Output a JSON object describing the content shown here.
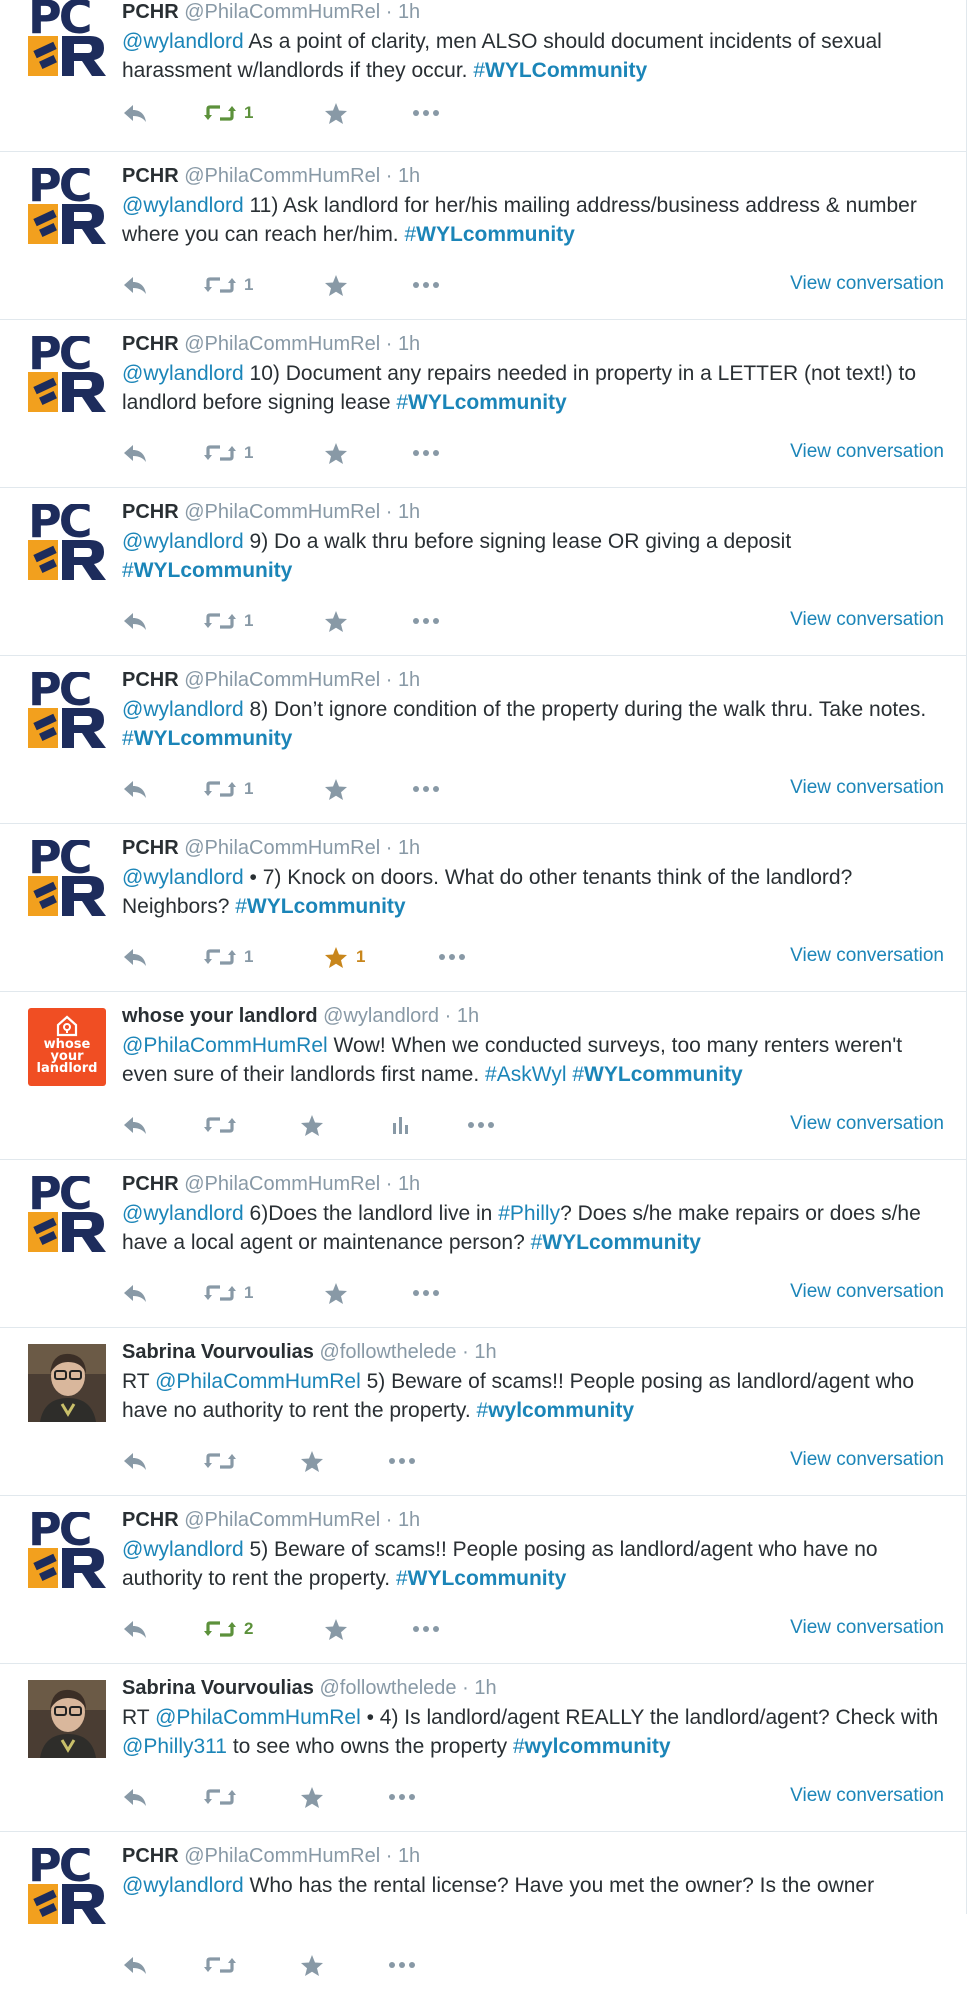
{
  "labels": {
    "view_conversation": "View conversation",
    "pc": "PC"
  },
  "wyl_logo_text": [
    "whose",
    "your",
    "landlord"
  ],
  "tweets": [
    {
      "avatar": "pchr",
      "name": "PCHR",
      "handle": "@PhilaCommHumRel",
      "dot": "·",
      "time": "1h",
      "segments": [
        {
          "t": "link",
          "v": "@wylandlord"
        },
        {
          "t": "text",
          "v": " As a point of clarity, men ALSO should document incidents of sexual harassment w/landlords if they occur. "
        },
        {
          "t": "hashtag",
          "hash": "#",
          "v": "WYLCommunity"
        }
      ],
      "retweets": "1",
      "retweet_active": true,
      "favorites": "",
      "favorite_active": false,
      "stats_icon": false,
      "view_conversation": false
    },
    {
      "avatar": "pchr",
      "name": "PCHR",
      "handle": "@PhilaCommHumRel",
      "dot": "·",
      "time": "1h",
      "segments": [
        {
          "t": "link",
          "v": "@wylandlord"
        },
        {
          "t": "text",
          "v": " 11) Ask landlord for her/his mailing address/business address & number where you can reach her/him. "
        },
        {
          "t": "hashtag",
          "hash": "#",
          "v": "WYLcommunity"
        }
      ],
      "retweets": "1",
      "retweet_active": false,
      "favorites": "",
      "favorite_active": false,
      "stats_icon": false,
      "view_conversation": true
    },
    {
      "avatar": "pchr",
      "name": "PCHR",
      "handle": "@PhilaCommHumRel",
      "dot": "·",
      "time": "1h",
      "segments": [
        {
          "t": "link",
          "v": "@wylandlord"
        },
        {
          "t": "text",
          "v": " 10) Document any repairs needed in property in a LETTER (not text!) to landlord before signing lease "
        },
        {
          "t": "hashtag",
          "hash": "#",
          "v": "WYLcommunity"
        }
      ],
      "retweets": "1",
      "retweet_active": false,
      "favorites": "",
      "favorite_active": false,
      "stats_icon": false,
      "view_conversation": true
    },
    {
      "avatar": "pchr",
      "name": "PCHR",
      "handle": "@PhilaCommHumRel",
      "dot": "·",
      "time": "1h",
      "segments": [
        {
          "t": "link",
          "v": "@wylandlord"
        },
        {
          "t": "text",
          "v": " 9) Do a walk thru before signing lease OR giving a deposit "
        },
        {
          "t": "hashtag",
          "hash": "#",
          "v": "WYLcommunity"
        }
      ],
      "retweets": "1",
      "retweet_active": false,
      "favorites": "",
      "favorite_active": false,
      "stats_icon": false,
      "view_conversation": true
    },
    {
      "avatar": "pchr",
      "name": "PCHR",
      "handle": "@PhilaCommHumRel",
      "dot": "·",
      "time": "1h",
      "segments": [
        {
          "t": "link",
          "v": "@wylandlord"
        },
        {
          "t": "text",
          "v": "  8) Don’t ignore condition of the property during the walk thru. Take notes. "
        },
        {
          "t": "hashtag",
          "hash": "#",
          "v": "WYLcommunity"
        }
      ],
      "retweets": "1",
      "retweet_active": false,
      "favorites": "",
      "favorite_active": false,
      "stats_icon": false,
      "view_conversation": true
    },
    {
      "avatar": "pchr",
      "name": "PCHR",
      "handle": "@PhilaCommHumRel",
      "dot": "·",
      "time": "1h",
      "segments": [
        {
          "t": "link",
          "v": "@wylandlord"
        },
        {
          "t": "text",
          "v": " • 7) Knock on doors. What do other tenants think of the landlord? Neighbors? "
        },
        {
          "t": "hashtag",
          "hash": "#",
          "v": "WYLcommunity"
        }
      ],
      "retweets": "1",
      "retweet_active": false,
      "favorites": "1",
      "favorite_active": true,
      "stats_icon": false,
      "view_conversation": true
    },
    {
      "avatar": "wyl",
      "name": "whose your landlord",
      "handle": "@wylandlord",
      "dot": "·",
      "time": "1h",
      "segments": [
        {
          "t": "link",
          "v": "@PhilaCommHumRel"
        },
        {
          "t": "text",
          "v": " Wow! When we conducted surveys, too many renters weren't even sure of their landlords first name. "
        },
        {
          "t": "link",
          "v": "#AskWyl"
        },
        {
          "t": "text",
          "v": " "
        },
        {
          "t": "hashtag",
          "hash": "#",
          "v": "WYLcommunity"
        }
      ],
      "retweets": "",
      "retweet_active": false,
      "favorites": "",
      "favorite_active": false,
      "stats_icon": true,
      "view_conversation": true
    },
    {
      "avatar": "pchr",
      "name": "PCHR",
      "handle": "@PhilaCommHumRel",
      "dot": "·",
      "time": "1h",
      "segments": [
        {
          "t": "link",
          "v": "@wylandlord"
        },
        {
          "t": "text",
          "v": " 6)Does the landlord live in "
        },
        {
          "t": "link",
          "v": "#Philly"
        },
        {
          "t": "text",
          "v": "? Does s/he make repairs or does s/he have a local agent or maintenance person? "
        },
        {
          "t": "hashtag",
          "hash": "#",
          "v": "WYLcommunity"
        }
      ],
      "retweets": "1",
      "retweet_active": false,
      "favorites": "",
      "favorite_active": false,
      "stats_icon": false,
      "view_conversation": true
    },
    {
      "avatar": "person",
      "name": "Sabrina Vourvoulias",
      "handle": "@followthelede",
      "dot": "·",
      "time": "1h",
      "segments": [
        {
          "t": "text",
          "v": "RT "
        },
        {
          "t": "link",
          "v": "@PhilaCommHumRel"
        },
        {
          "t": "text",
          "v": " 5) Beware of scams!! People posing as landlord/agent who have no authority to rent the property.  "
        },
        {
          "t": "hashtag",
          "hash": "#",
          "v": "wylcommunity"
        }
      ],
      "retweets": "",
      "retweet_active": false,
      "favorites": "",
      "favorite_active": false,
      "stats_icon": false,
      "view_conversation": true
    },
    {
      "avatar": "pchr",
      "name": "PCHR",
      "handle": "@PhilaCommHumRel",
      "dot": "·",
      "time": "1h",
      "segments": [
        {
          "t": "link",
          "v": "@wylandlord"
        },
        {
          "t": "text",
          "v": " 5) Beware of scams!! People posing as landlord/agent who have no authority to rent the property. "
        },
        {
          "t": "hashtag",
          "hash": "#",
          "v": "WYLcommunity"
        }
      ],
      "retweets": "2",
      "retweet_active": true,
      "favorites": "",
      "favorite_active": false,
      "stats_icon": false,
      "view_conversation": true
    },
    {
      "avatar": "person",
      "name": "Sabrina Vourvoulias",
      "handle": "@followthelede",
      "dot": "·",
      "time": "1h",
      "segments": [
        {
          "t": "text",
          "v": "RT "
        },
        {
          "t": "link",
          "v": "@PhilaCommHumRel"
        },
        {
          "t": "text",
          "v": "  • 4) Is landlord/agent REALLY the landlord/agent? Check with "
        },
        {
          "t": "link",
          "v": "@Philly311"
        },
        {
          "t": "text",
          "v": " to see who owns the property "
        },
        {
          "t": "hashtag",
          "hash": "#",
          "v": "wylcommunity"
        }
      ],
      "retweets": "",
      "retweet_active": false,
      "favorites": "",
      "favorite_active": false,
      "stats_icon": false,
      "view_conversation": true
    },
    {
      "avatar": "pchr",
      "name": "PCHR",
      "handle": "@PhilaCommHumRel",
      "dot": "·",
      "time": "1h",
      "segments": [
        {
          "t": "link",
          "v": "@wylandlord"
        },
        {
          "t": "text",
          "v": " Who has the rental license? Have you met the owner? Is the owner"
        }
      ],
      "retweets": "",
      "retweet_active": false,
      "favorites": "",
      "favorite_active": false,
      "stats_icon": false,
      "view_conversation": false
    }
  ],
  "colors": {
    "link": "#1b85b8",
    "muted": "#8899a6",
    "retweet_active": "#5c913b",
    "favorite_active": "#c8861c",
    "wyl_orange": "#f04e23",
    "pchr_navy": "#1d2c5c",
    "pchr_gold": "#f2a01e"
  },
  "icons": [
    "reply-icon",
    "retweet-icon",
    "favorite-icon",
    "stats-icon",
    "more-icon"
  ]
}
